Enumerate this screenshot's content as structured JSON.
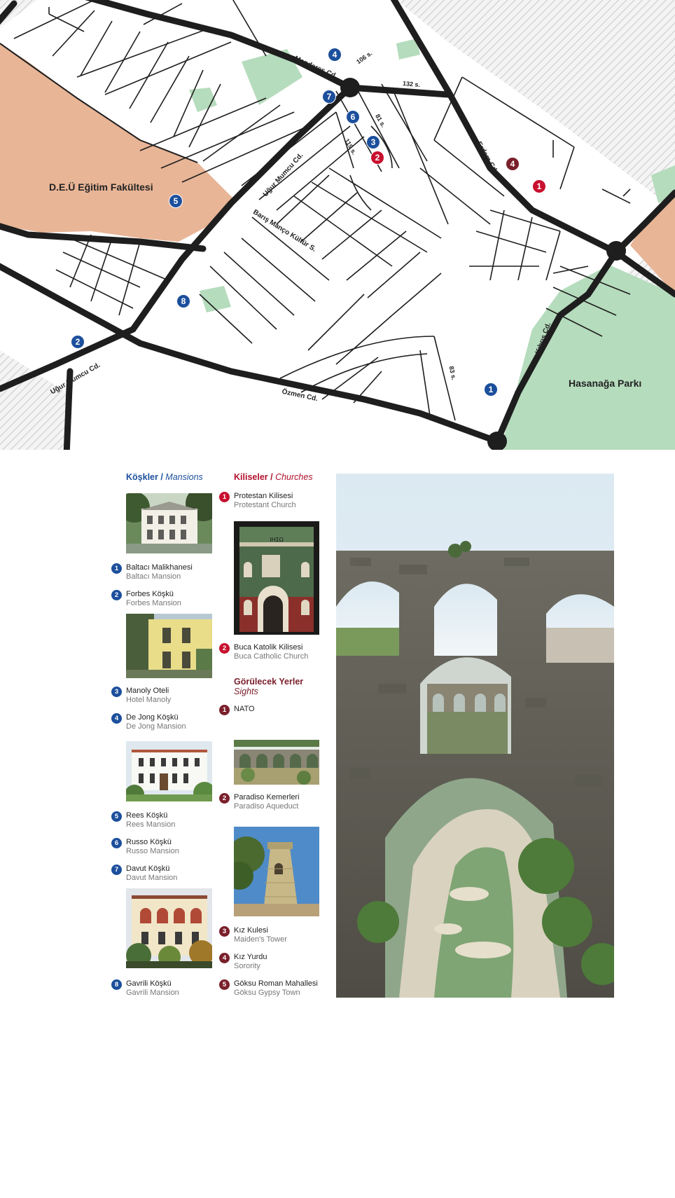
{
  "map": {
    "streets": {
      "menderes": "Menderes Cd.",
      "s106": "106 s.",
      "s132": "132 s.",
      "s81": "81 s.",
      "s119": "119 s.",
      "ugur_mumcu_1": "Uğur Mumcu Cd.",
      "ugur_mumcu_2": "Uğur Mumcu Cd.",
      "baris_manco": "Barış Manço Kültür S.",
      "erdem": "Erdem Cd.",
      "kibris": "Kıbrıs Cd.",
      "ozmen": "Özmen Cd.",
      "s83": "83 s."
    },
    "areas": {
      "deu": "D.E.Ü Eğitim Fakültesi",
      "hasanaga": "Hasanağa Parkı"
    },
    "markers": [
      {
        "n": "1",
        "kind": "maroon"
      },
      {
        "n": "2",
        "kind": "red"
      },
      {
        "n": "3",
        "kind": "blue"
      },
      {
        "n": "4",
        "kind": "blue"
      },
      {
        "n": "4",
        "kind": "maroon"
      },
      {
        "n": "5",
        "kind": "blue"
      },
      {
        "n": "6",
        "kind": "blue"
      },
      {
        "n": "7",
        "kind": "blue"
      },
      {
        "n": "8",
        "kind": "blue"
      },
      {
        "n": "2",
        "kind": "blue"
      },
      {
        "n": "1",
        "kind": "blue"
      }
    ]
  },
  "legend": {
    "mansions": {
      "title": "Köşkler /",
      "title_en": "Mansions",
      "items": [
        {
          "n": "1",
          "tr": "Baltacı Malikhanesi",
          "en": "Baltacı Mansion"
        },
        {
          "n": "2",
          "tr": "Forbes Köşkü",
          "en": "Forbes Mansion"
        },
        {
          "n": "3",
          "tr": "Manoly Oteli",
          "en": "Hotel Manoly"
        },
        {
          "n": "4",
          "tr": "De Jong Köşkü",
          "en": "De Jong  Mansion"
        },
        {
          "n": "5",
          "tr": "Rees Köşkü",
          "en": "Rees Mansion"
        },
        {
          "n": "6",
          "tr": "Russo Köşkü",
          "en": "Russo Mansion"
        },
        {
          "n": "7",
          "tr": "Davut Köşkü",
          "en": "Davut Mansion"
        },
        {
          "n": "8",
          "tr": "Gavrili Köşkü",
          "en": "Gavrili Mansion"
        }
      ]
    },
    "churches": {
      "title": "Kiliseler /",
      "title_en": "Churches",
      "items": [
        {
          "n": "1",
          "tr": "Protestan Kilisesi",
          "en": "Protestant Church"
        },
        {
          "n": "2",
          "tr": "Buca Katolik Kilisesi",
          "en": "Buca Catholic Church"
        }
      ]
    },
    "sights": {
      "title": "Görülecek Yerler",
      "title_en": "Sights",
      "items": [
        {
          "n": "1",
          "tr": "NATO",
          "en": ""
        },
        {
          "n": "2",
          "tr": "Paradiso Kemerleri",
          "en": "Paradiso Aqueduct"
        },
        {
          "n": "3",
          "tr": "Kız Kulesi",
          "en": "Maiden's Tower"
        },
        {
          "n": "4",
          "tr": "Kız Yurdu",
          "en": "Sorority"
        },
        {
          "n": "5",
          "tr": "Göksu Roman Mahallesi",
          "en": "Göksu Gypsy Town"
        }
      ]
    },
    "church_photo_sign": "ΙΗΣΩ"
  }
}
